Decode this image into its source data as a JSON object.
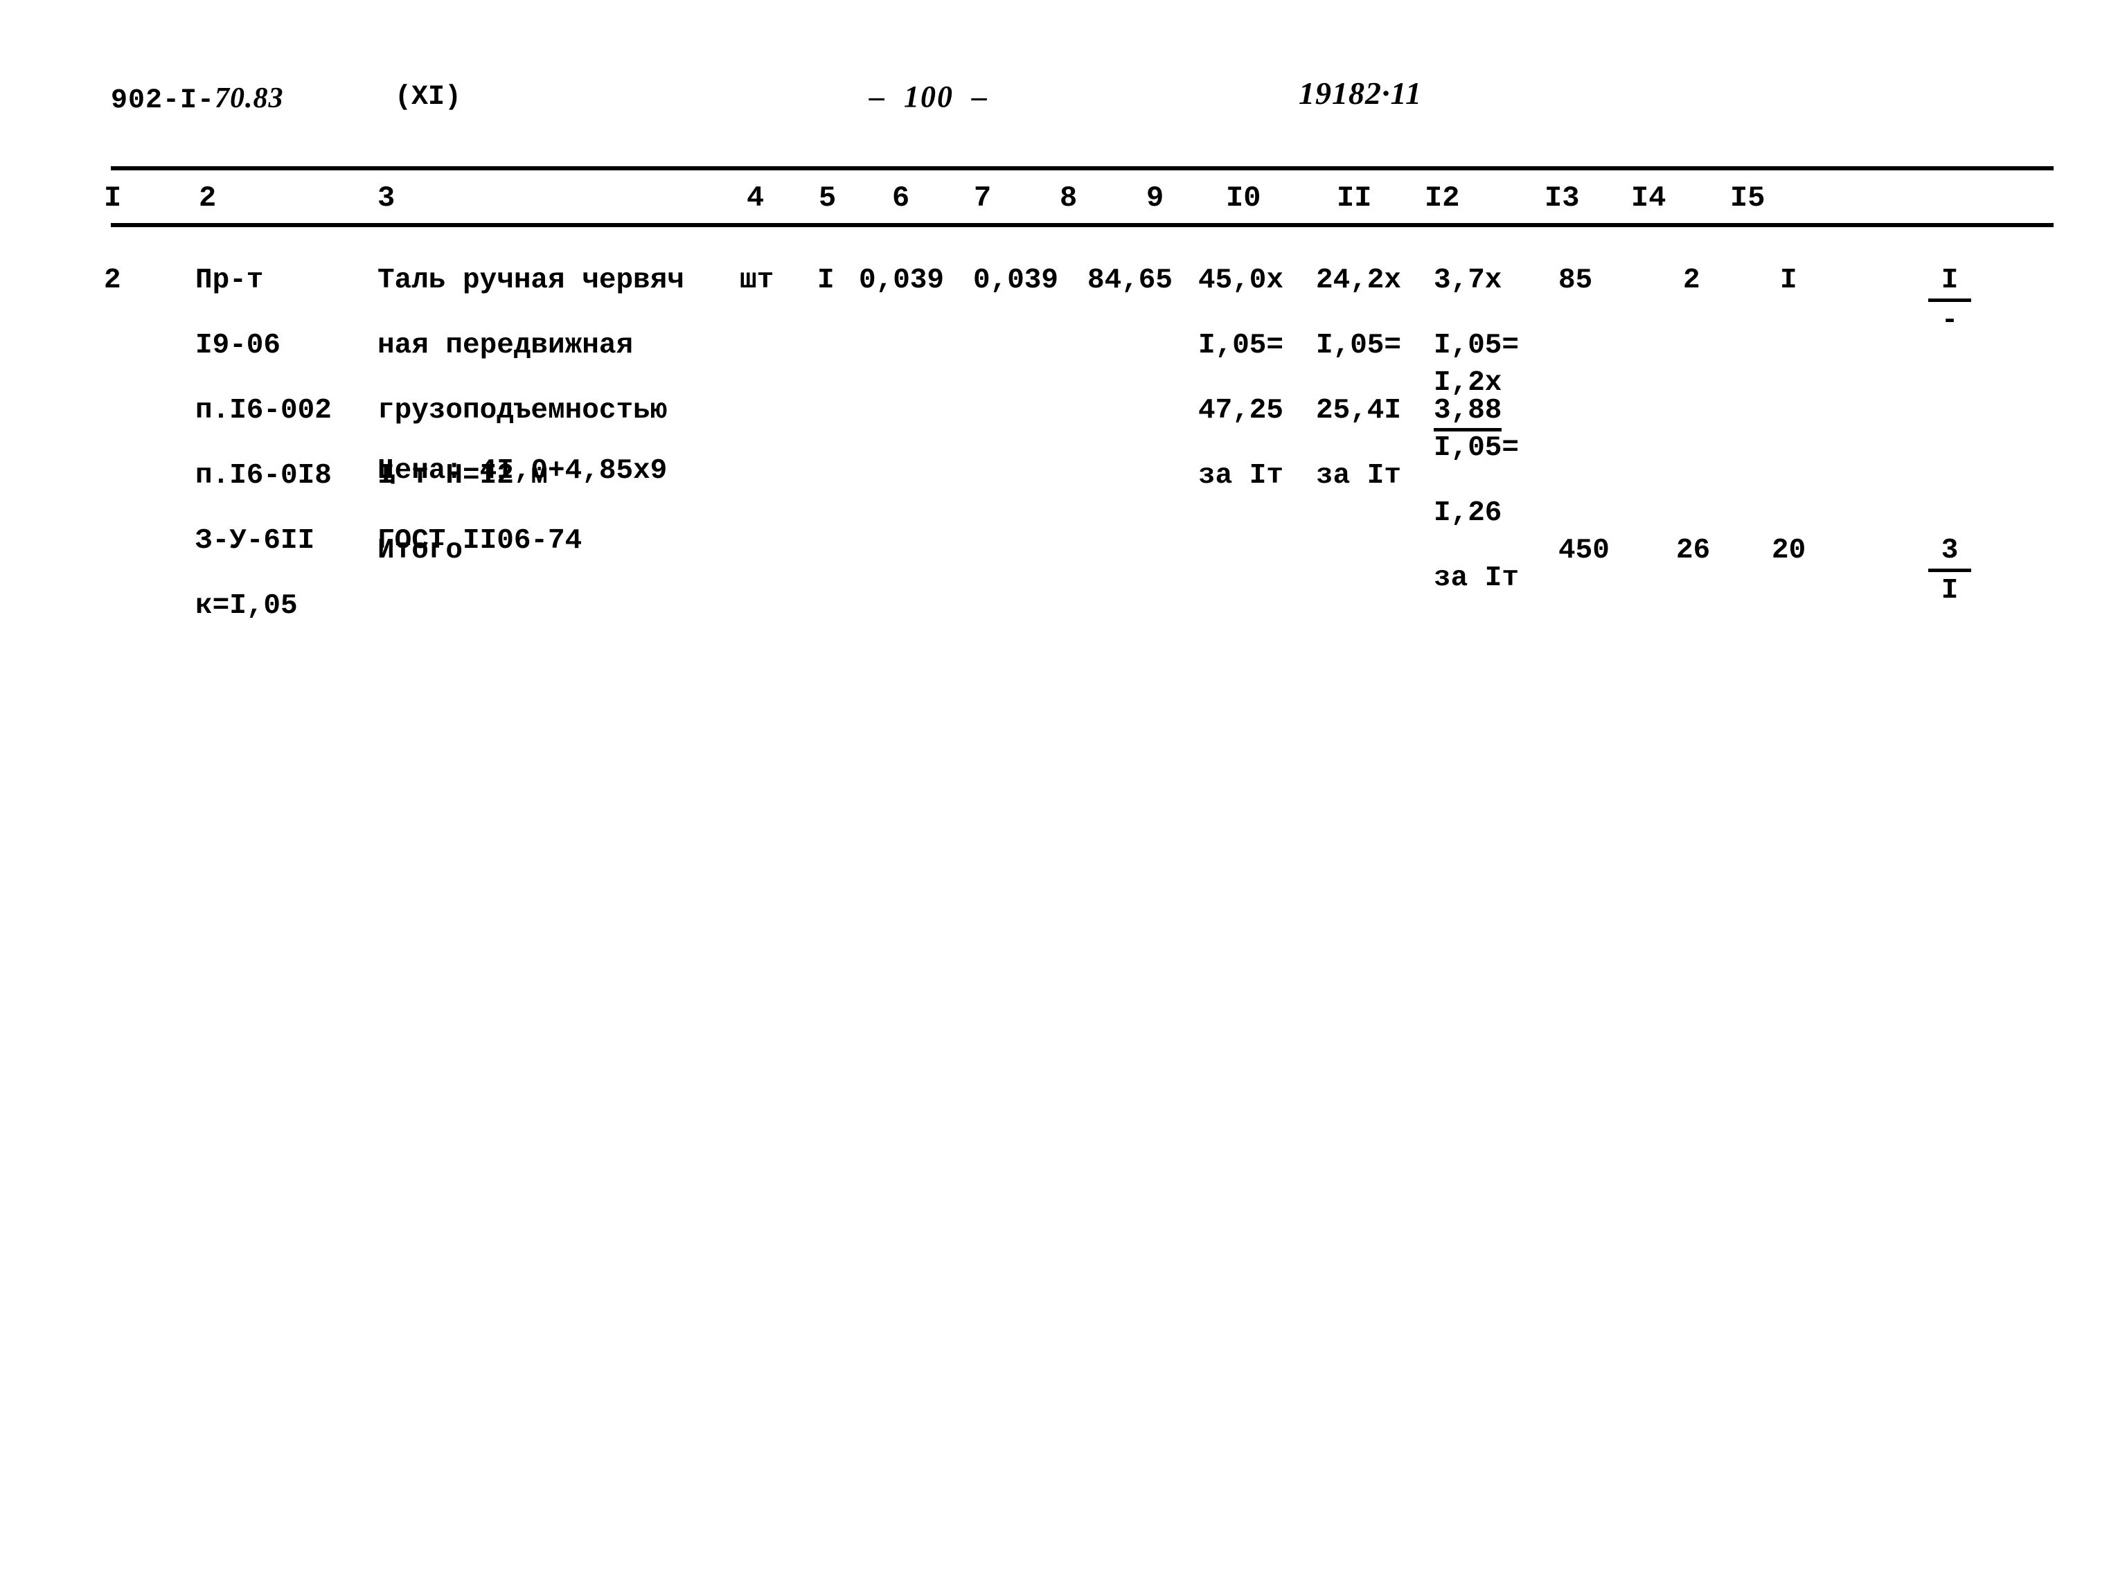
{
  "header": {
    "doc_number_prefix": "902-I-",
    "doc_number_hand": "70.83",
    "part": "(XI)",
    "page_marker": "–  100  –",
    "stamp": "19182·11"
  },
  "table": {
    "column_headers": [
      "I",
      "2",
      "3",
      "4",
      "5",
      "6",
      "7",
      "8",
      "9",
      "I0",
      "II",
      "I2",
      "I3",
      "I4",
      "I5"
    ],
    "rows": [
      {
        "col1": "2",
        "col2_lines": [
          "Пр-т",
          "I9-06",
          "п.I6-002",
          "п.I6-0I8",
          "З-У-6II",
          "к=I,05"
        ],
        "col3_lines": [
          "Таль ручная червяч",
          "ная передвижная",
          "грузоподъемностью",
          "I т Н=I2 м",
          "ГОСТ II06-74"
        ],
        "col3_price": "Цена: 4I,0+4,85x9",
        "col4": "шт",
        "col5": "I",
        "col6": "0,039",
        "col7": "0,039",
        "col8": "84,65",
        "col9_lines": [
          "45,0х",
          "I,05=",
          "47,25",
          "за Iт"
        ],
        "col10_lines": [
          "24,2х",
          "I,05=",
          "25,4I",
          "за Iт"
        ],
        "col11_lines_a": [
          "3,7х",
          "I,05="
        ],
        "col11_underlined": "3,88",
        "col11_lines_b": [
          "I,2х",
          "I,05=",
          "I,26",
          "за Iт"
        ],
        "col12": "85",
        "col13": "2",
        "col14": "I",
        "col15_num": "I",
        "col15_den": "-"
      }
    ],
    "total_row": {
      "label": "Итого",
      "col12": "450",
      "col13": "26",
      "col14": "20",
      "col15_num": "3",
      "col15_den": "I"
    }
  }
}
